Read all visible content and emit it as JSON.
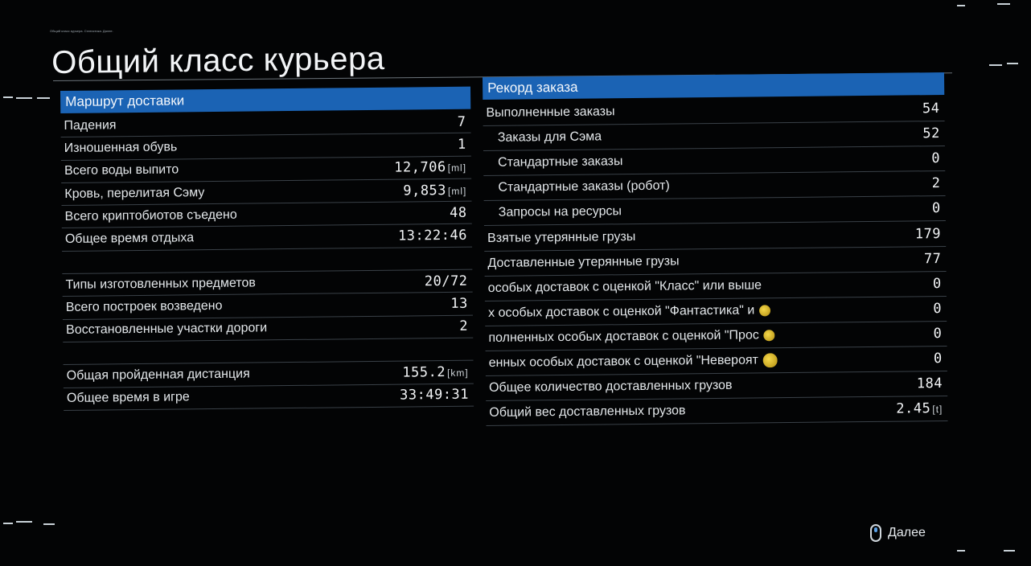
{
  "header": {
    "small_text": "Общий класс курьера. Статистика. Далее.",
    "title": "Общий класс курьера"
  },
  "left_panel": {
    "header": "Маршрут доставки",
    "rows": [
      {
        "label": "Падения",
        "value": "7",
        "unit": ""
      },
      {
        "label": "Изношенная обувь",
        "value": "1",
        "unit": ""
      },
      {
        "label": "Всего воды выпито",
        "value": "12,706",
        "unit": "[ml]"
      },
      {
        "label": "Кровь, перелитая Сэму",
        "value": "9,853",
        "unit": "[ml]"
      },
      {
        "label": "Всего криптобиотов съедено",
        "value": "48",
        "unit": ""
      },
      {
        "label": "Общее время отдыха",
        "value": "13:22:46",
        "unit": ""
      },
      {
        "label": "",
        "value": "",
        "unit": ""
      },
      {
        "label": "Типы изготовленных предметов",
        "value": "20/72",
        "unit": ""
      },
      {
        "label": "Всего построек возведено",
        "value": "13",
        "unit": ""
      },
      {
        "label": "Восстановленные участки дороги",
        "value": "2",
        "unit": ""
      },
      {
        "label": "",
        "value": "",
        "unit": ""
      },
      {
        "label": "Общая пройденная дистанция",
        "value": "155.2",
        "unit": "[km]"
      },
      {
        "label": "Общее время в игре",
        "value": "33:49:31",
        "unit": ""
      }
    ]
  },
  "right_panel": {
    "header": "Рекорд заказа",
    "rows": [
      {
        "label": "Выполненные заказы",
        "value": "54"
      },
      {
        "label": "Заказы для Сэма",
        "value": "52"
      },
      {
        "label": "Стандартные заказы",
        "value": "0"
      },
      {
        "label": "Стандартные заказы (робот)",
        "value": "2"
      },
      {
        "label": "Запросы на ресурсы",
        "value": "0"
      },
      {
        "label": "Взятые утерянные грузы",
        "value": "179"
      },
      {
        "label": "Доставленные утерянные грузы",
        "value": "77"
      },
      {
        "label": "особых доставок с оценкой \"Класс\" или выше",
        "value": "0"
      },
      {
        "label": "х особых доставок с оценкой \"Фантастика\" и",
        "value": "0"
      },
      {
        "label": "полненных особых доставок с оценкой \"Прос",
        "value": "0"
      },
      {
        "label": "енных особых доставок с оценкой \"Невероят",
        "value": "0"
      },
      {
        "label": "Общее количество доставленных грузов",
        "value": "184"
      },
      {
        "label": "Общий вес доставленных грузов",
        "value": "2.45",
        "unit": "[t]"
      }
    ]
  },
  "footer": {
    "next_label": "Далее"
  },
  "colors": {
    "header_blue": "#1b63b4",
    "medal_gold": "#e0c030"
  },
  "icons": {
    "next": "mouse-icon",
    "medal": "gold-medal-icon"
  }
}
